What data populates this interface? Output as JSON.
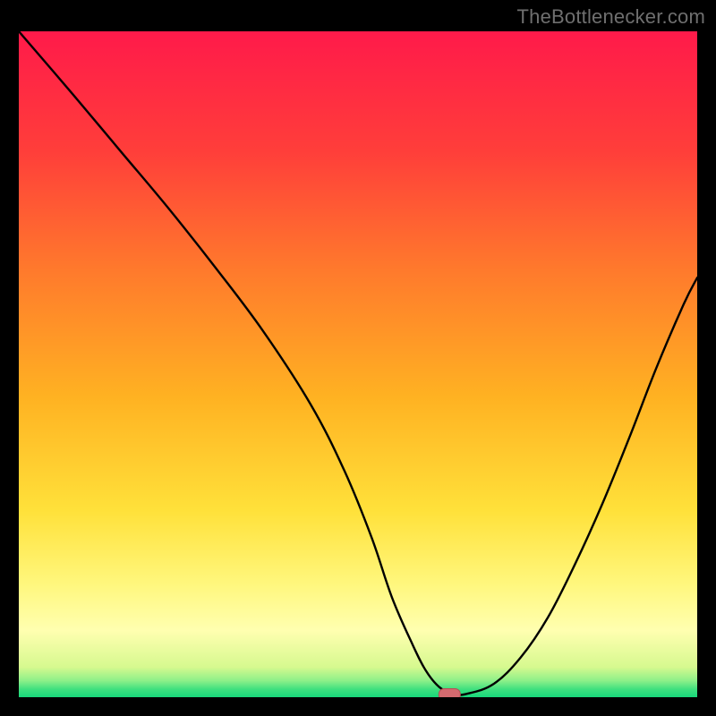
{
  "watermark": "TheBottlenecker.com",
  "colors": {
    "page_bg": "#000000",
    "gradient_stops": [
      {
        "offset": 0.0,
        "color": "#ff1a4a"
      },
      {
        "offset": 0.18,
        "color": "#ff3e3a"
      },
      {
        "offset": 0.36,
        "color": "#ff7a2c"
      },
      {
        "offset": 0.55,
        "color": "#ffb222"
      },
      {
        "offset": 0.72,
        "color": "#ffe13a"
      },
      {
        "offset": 0.83,
        "color": "#fff77d"
      },
      {
        "offset": 0.9,
        "color": "#ffffb0"
      },
      {
        "offset": 0.955,
        "color": "#d6f98f"
      },
      {
        "offset": 0.975,
        "color": "#8ef089"
      },
      {
        "offset": 0.988,
        "color": "#3fe07f"
      },
      {
        "offset": 1.0,
        "color": "#18d87b"
      }
    ],
    "curve": "#000000",
    "marker_fill": "#d46a6f",
    "marker_stroke": "#b64f55"
  },
  "chart_data": {
    "type": "line",
    "title": "",
    "xlabel": "",
    "ylabel": "",
    "xlim": [
      0,
      100
    ],
    "ylim": [
      0,
      100
    ],
    "x": [
      0,
      8,
      15,
      22,
      29,
      36,
      43,
      48,
      52,
      55,
      58,
      60,
      62,
      64,
      66,
      70,
      74,
      78,
      82,
      86,
      90,
      94,
      98,
      100
    ],
    "values": [
      100,
      90.5,
      82,
      73.5,
      64.5,
      55,
      44,
      34,
      24,
      15,
      8,
      4,
      1.5,
      0.5,
      0.5,
      2,
      6,
      12,
      20,
      29,
      39,
      49.5,
      59,
      63
    ],
    "ticks_x": [],
    "ticks_y": [],
    "grid": false,
    "legend": null,
    "marker": {
      "x": 63.5,
      "y": 0.4,
      "shape": "rounded-rect"
    }
  }
}
